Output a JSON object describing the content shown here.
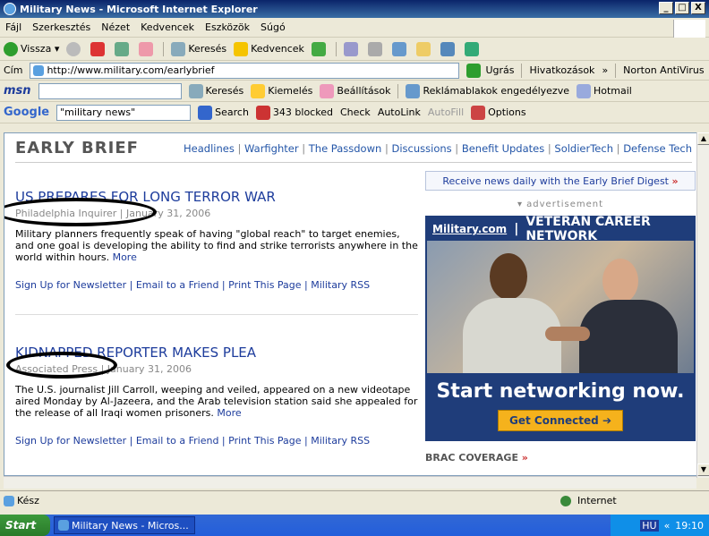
{
  "window": {
    "title": "Military News - Microsoft Internet Explorer",
    "min": "_",
    "max": "□",
    "close": "X"
  },
  "menu": [
    "Fájl",
    "Szerkesztés",
    "Nézet",
    "Kedvencek",
    "Eszközök",
    "Súgó"
  ],
  "toolbar": {
    "back": "Vissza",
    "search": "Keresés",
    "favorites": "Kedvencek"
  },
  "address": {
    "label": "Cím",
    "url": "http://www.military.com/earlybrief",
    "go": "Ugrás",
    "links": "Hivatkozások",
    "norton": "Norton AntiVirus"
  },
  "msn": {
    "logo": "msn",
    "search": "Keresés",
    "highlight": "Kiemelés",
    "settings": "Beállítások",
    "popups": "Reklámablakok engedélyezve",
    "hotmail": "Hotmail"
  },
  "google": {
    "logo": "Google",
    "query": "\"military news\"",
    "search": "Search",
    "blocked": "343 blocked",
    "check": "Check",
    "autolink": "AutoLink",
    "autofill": "AutoFill",
    "options": "Options"
  },
  "page": {
    "header": "EARLY BRIEF",
    "nav": [
      "Headlines",
      "Warfighter",
      "The Passdown",
      "Discussions",
      "Benefit Updates",
      "SoldierTech",
      "Defense Tech"
    ],
    "articles": [
      {
        "title": "US PREPARES FOR LONG TERROR WAR",
        "source": "Philadelphia Inquirer",
        "date": "January 31, 2006",
        "body": "Military planners frequently speak of having \"global reach\" to target enemies, and one goal is developing the ability to find and strike terrorists anywhere in the world within hours.",
        "more": "More"
      },
      {
        "title": "KIDNAPPED REPORTER MAKES PLEA",
        "source": "Associated Press",
        "date": "January 31, 2006",
        "body": "The U.S. journalist Jill Carroll, weeping and veiled, appeared on a new videotape aired Monday by Al-Jazeera, and the Arab television station said she appealed for the release of all Iraqi women prisoners.",
        "more": "More"
      }
    ],
    "links": [
      "Sign Up for Newsletter",
      "Email to a Friend",
      "Print This Page",
      "Military RSS"
    ],
    "subscribe": "Receive news daily with the Early Brief Digest",
    "advert_label": "advertisement",
    "ad": {
      "logo": "Military.com",
      "tagline": "VETERAN CAREER NETWORK",
      "cta": "Start networking now.",
      "button": "Get Connected"
    },
    "brac": "BRAC COVERAGE"
  },
  "status": {
    "text": "Kész",
    "zone": "Internet"
  },
  "taskbar": {
    "start": "Start",
    "item": "Military News - Micros...",
    "lang": "HU",
    "clock": "19:10"
  }
}
